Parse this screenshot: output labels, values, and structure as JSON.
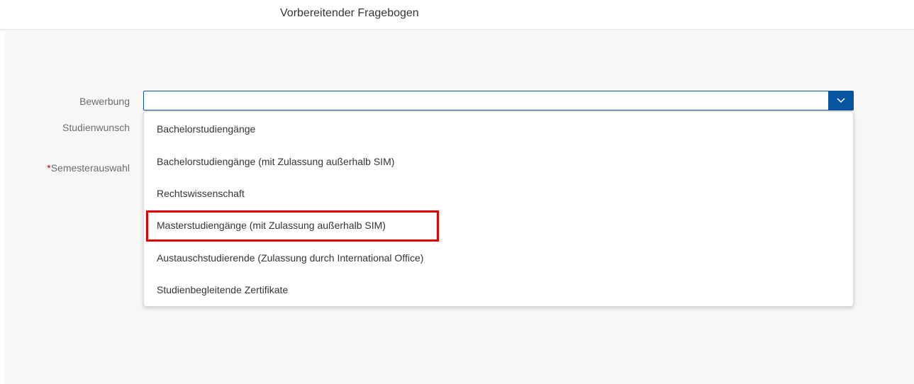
{
  "header": {
    "title": "Vorbereitender Fragebogen"
  },
  "form": {
    "bewerbung_label": "Bewerbung",
    "studienwunsch_label": "Studienwunsch",
    "semester_required_mark": "*",
    "semester_label": "Semesterauswahl",
    "bewerbung_value": ""
  },
  "dropdown": {
    "items": [
      {
        "label": "Bachelorstudiengänge"
      },
      {
        "label": "Bachelorstudiengänge (mit Zulassung außerhalb SIM)"
      },
      {
        "label": "Rechtswissenschaft"
      },
      {
        "label": "Masterstudiengänge (mit Zulassung außerhalb SIM)",
        "highlighted": true
      },
      {
        "label": "Austauschstudierende (Zulassung durch International Office)"
      },
      {
        "label": "Studienbegleitende Zertifikate"
      }
    ]
  },
  "colors": {
    "accent": "#0854a0",
    "highlight_border": "#e00000",
    "required": "#bb0000",
    "background": "#f7f7f7"
  },
  "icons": {
    "combo_arrow": "chevron-down-icon"
  }
}
